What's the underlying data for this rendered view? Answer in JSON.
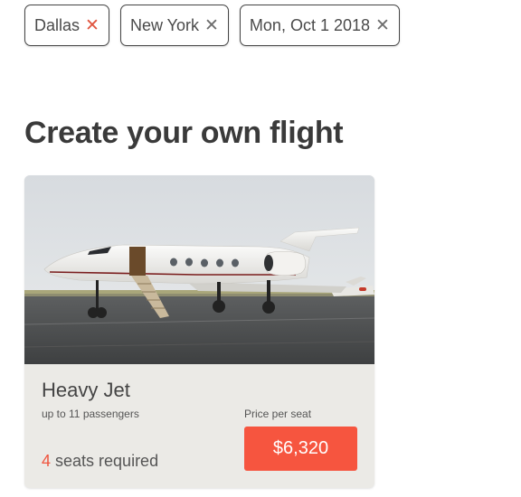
{
  "filters": [
    {
      "label": "Dallas",
      "remove_icon": "close-icon",
      "remove_color": "#e0553f"
    },
    {
      "label": "New York",
      "remove_icon": "close-icon",
      "remove_color": "#6d6d6d"
    },
    {
      "label": "Mon, Oct 1 2018",
      "remove_icon": "close-icon",
      "remove_color": "#6d6d6d"
    }
  ],
  "close_glyph": "✕",
  "title": "Create your own flight",
  "card": {
    "jet_name": "Heavy Jet",
    "capacity": "up to 11 passengers",
    "price_label": "Price per seat",
    "seats_count": "4",
    "seats_text": " seats required",
    "price": "$6,320"
  },
  "colors": {
    "accent": "#f6553f",
    "card_bg": "#ebeae6"
  }
}
